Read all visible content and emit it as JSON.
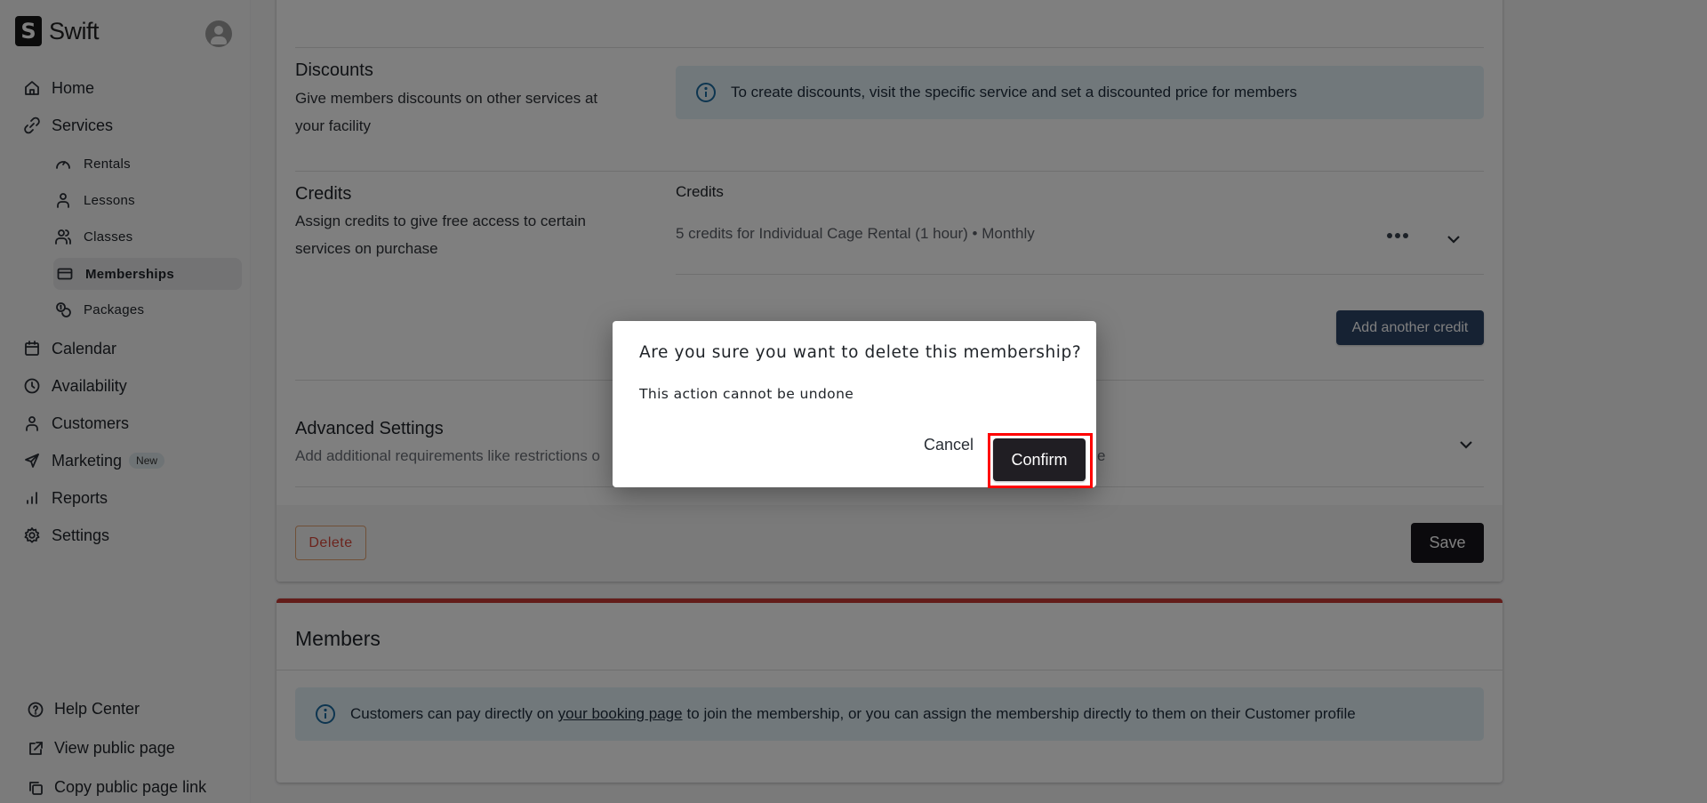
{
  "brand": {
    "name": "Swift",
    "logo_letter": "S"
  },
  "sidebar": {
    "items": [
      {
        "label": "Home",
        "icon": "home-icon"
      },
      {
        "label": "Services",
        "icon": "link-icon"
      },
      {
        "label": "Calendar",
        "icon": "calendar-icon"
      },
      {
        "label": "Availability",
        "icon": "clock-icon"
      },
      {
        "label": "Customers",
        "icon": "user-icon"
      },
      {
        "label": "Marketing",
        "icon": "send-icon",
        "badge": "New"
      },
      {
        "label": "Reports",
        "icon": "bar-chart-icon"
      },
      {
        "label": "Settings",
        "icon": "gear-icon"
      }
    ],
    "services_sub": [
      {
        "label": "Rentals",
        "icon": "gauge-icon"
      },
      {
        "label": "Lessons",
        "icon": "user-icon"
      },
      {
        "label": "Classes",
        "icon": "users-icon"
      },
      {
        "label": "Memberships",
        "icon": "card-icon",
        "active": true
      },
      {
        "label": "Packages",
        "icon": "coins-icon"
      }
    ],
    "footer": [
      {
        "label": "Help Center",
        "icon": "help-circle-icon"
      },
      {
        "label": "View public page",
        "icon": "external-link-icon"
      },
      {
        "label": "Copy public page link",
        "icon": "copy-icon"
      }
    ]
  },
  "membership_form": {
    "discounts": {
      "title": "Discounts",
      "description": "Give members discounts on other services at your facility",
      "info": "To create discounts, visit the specific service and set a discounted price for members"
    },
    "credits": {
      "title": "Credits",
      "description": "Assign credits to give free access to certain services on purchase",
      "list_label": "Credits",
      "items": [
        "5 credits for Individual Cage Rental (1 hour) • Monthly"
      ],
      "add_button": "Add another credit"
    },
    "advanced": {
      "title": "Advanced Settings",
      "description_visible": "Add additional requirements like restrictions o",
      "description_tail": "e"
    },
    "delete_button": "Delete",
    "save_button": "Save"
  },
  "members": {
    "title": "Members",
    "info_before": "Customers can pay directly on",
    "info_link": "your booking page",
    "info_after": "to join the membership, or you can assign the membership directly to them on their Customer profile"
  },
  "dialog": {
    "title": "Are you sure you want to delete this membership?",
    "message": "This action cannot be undone",
    "cancel": "Cancel",
    "confirm": "Confirm"
  }
}
